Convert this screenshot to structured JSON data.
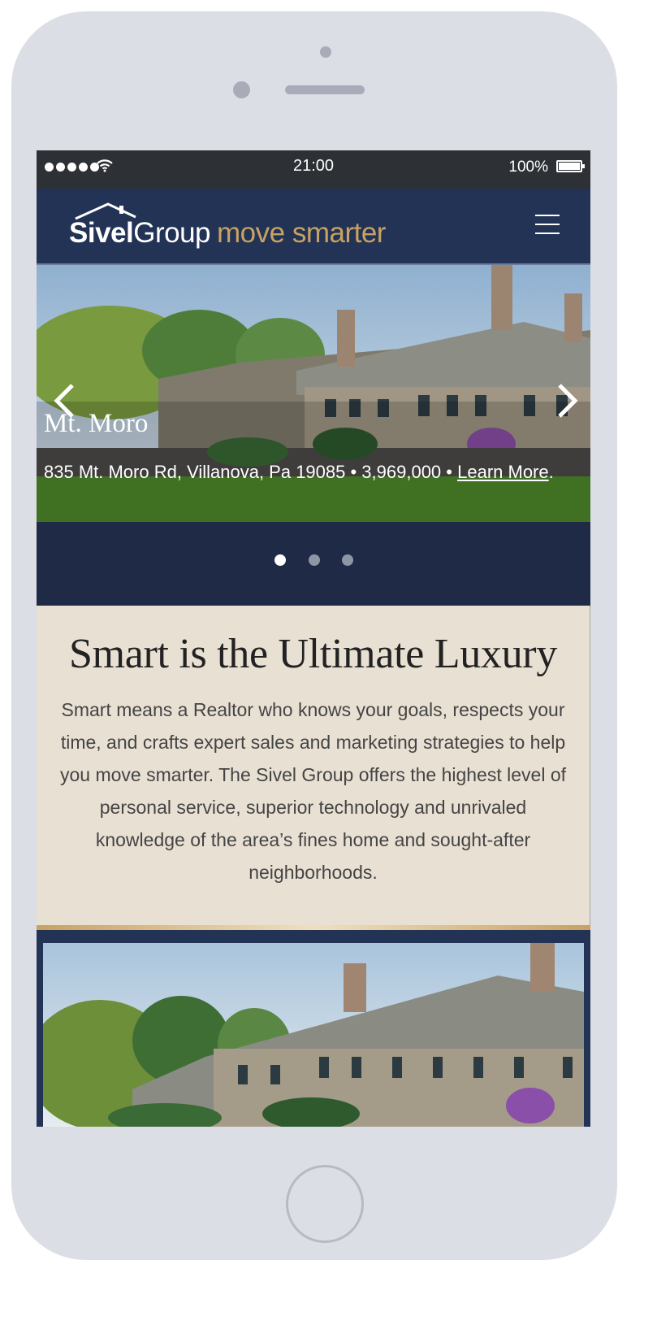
{
  "status_bar": {
    "time": "21:00",
    "battery_percent": "100%",
    "icons": [
      "signal-dots-icon",
      "wifi-icon",
      "battery-icon"
    ]
  },
  "header": {
    "logo": {
      "brand_bold": "Sivel",
      "brand_light": "Group",
      "tagline": "move smarter"
    },
    "menu_icon": "hamburger-icon"
  },
  "hero": {
    "title": "Mt. Moro",
    "details": "835 Mt. Moro Rd, Villanova, Pa 19085 • 3,969,000 •",
    "link_label": "Learn More",
    "link_suffix": ".",
    "prev_icon": "chevron-left-icon",
    "next_icon": "chevron-right-icon",
    "active_slide": 1,
    "slide_count": 3
  },
  "intro": {
    "heading": "Smart is the Ultimate Luxury",
    "body": "Smart means a Realtor who knows your goals, respects your time, and crafts expert sales and marketing strategies to help you move smarter. The Sivel Group offers the highest level of personal service, superior technology and unrivaled knowledge of the area’s fines home and sought-after neighborhoods."
  },
  "colors": {
    "navy": "#223355",
    "gold": "#c7a263",
    "cream": "#e8e0d3",
    "device": "#dcdee5"
  }
}
